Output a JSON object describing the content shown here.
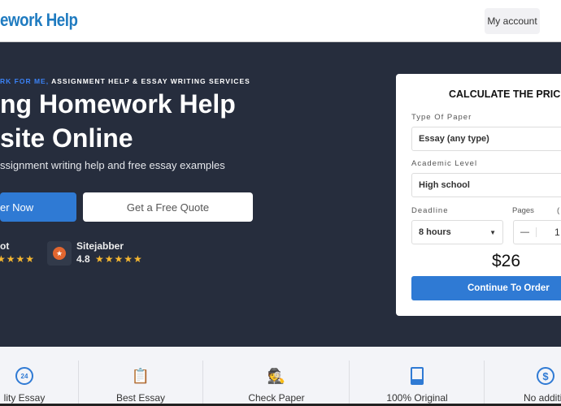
{
  "header": {
    "logo": "ework Help",
    "account_button": "My account"
  },
  "hero": {
    "eyebrow_blue": "RK FOR ME,",
    "eyebrow_rest": "ASSIGNMENT HELP & ESSAY WRITING SERVICES",
    "title_line1": "ng Homework Help",
    "title_line2": "site Online",
    "subtitle": "ssignment writing help and free essay examples",
    "order_button": "er Now",
    "quote_button": "Get a Free Quote",
    "reviews": [
      {
        "name": "ot",
        "stars": "★★★★"
      },
      {
        "name": "Sitejabber",
        "rating": "4.8",
        "stars": "★★★★★"
      }
    ]
  },
  "calculator": {
    "title": "CALCULATE THE PRIC",
    "type_label": "Type Of Paper",
    "type_value": "Essay (any type)",
    "level_label": "Academic Level",
    "level_value": "High school",
    "deadline_label": "Deadline",
    "deadline_value": "8 hours",
    "pages_label": "Pages",
    "pages_extra": "(",
    "pages_value": "1",
    "minus": "—",
    "price": "$26",
    "continue_button": "Continue To Order"
  },
  "features": [
    {
      "label": "lity Essay",
      "icon": "clock-24-icon"
    },
    {
      "label": "Best Essay",
      "icon": "clipboard-icon"
    },
    {
      "label": "Check Paper",
      "icon": "spy-icon"
    },
    {
      "label": "100% Original",
      "icon": "paper-icon"
    },
    {
      "label": "No additio",
      "icon": "no-dollar-icon"
    }
  ],
  "colors": {
    "accent": "#2f7ad4",
    "hero_bg": "#262d3d",
    "star": "#f5b731"
  }
}
